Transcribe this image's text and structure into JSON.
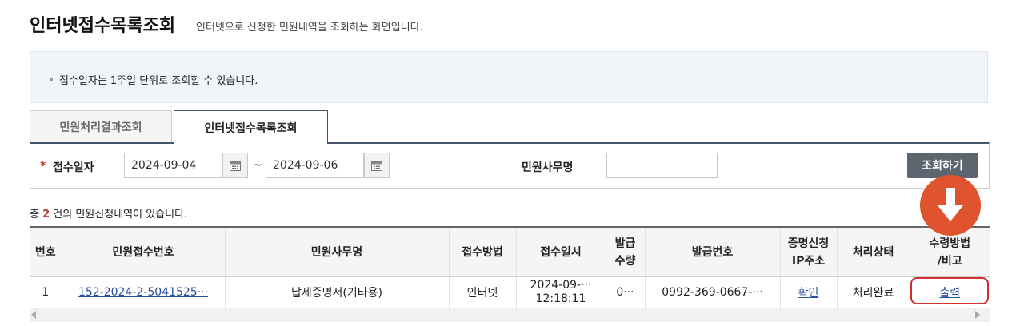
{
  "header": {
    "title": "인터넷접수목록조회",
    "subtitle": "인터넷으로 신청한 민원내역을 조회하는 화면입니다."
  },
  "notice": {
    "text": "접수일자는 1주일 단위로 조회할 수 있습니다."
  },
  "tabs": [
    {
      "label": "민원처리결과조회",
      "active": false
    },
    {
      "label": "인터넷접수목록조회",
      "active": true
    }
  ],
  "search": {
    "date_label": "접수일자",
    "required_mark": "*",
    "date_from": "2024-09-04",
    "date_to": "2024-09-06",
    "separator": "~",
    "office_label": "민원사무명",
    "office_value": "",
    "button_label": "조회하기"
  },
  "summary": {
    "prefix": "총",
    "count": "2",
    "suffix": "건의 민원신청내역이 있습니다."
  },
  "table": {
    "headers": [
      "번호",
      "민원접수번호",
      "민원사무명",
      "접수방법",
      "접수일시",
      "발급\n수량",
      "발급번호",
      "증명신청\nIP주소",
      "처리상태",
      "수령방법\n/비고"
    ],
    "rows": [
      {
        "no": "1",
        "receipt_no": "152-2024-2-5041525···",
        "office_name": "납세증명서(기타용)",
        "method": "인터넷",
        "date_line1": "2024-09-···",
        "date_line2": "12:18:11",
        "qty": "0···",
        "issue_no": "0992-369-0667-···",
        "ip": "확인",
        "status": "처리완료",
        "receive": "출력"
      }
    ]
  },
  "colors": {
    "accent": "#45556a",
    "required": "#c0392b",
    "arrow_badge": "#e0532f",
    "highlight": "#d12e2e",
    "link": "#2a4f9c"
  }
}
